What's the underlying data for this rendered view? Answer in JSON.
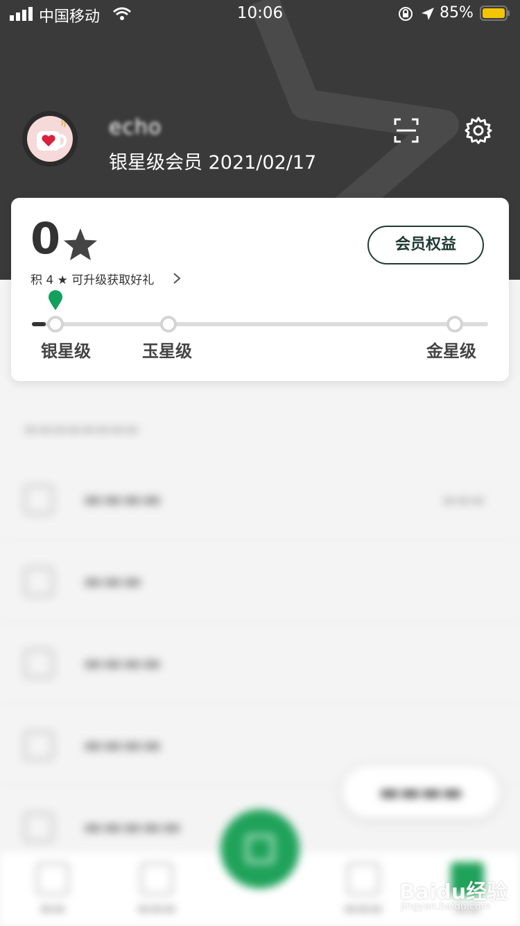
{
  "status_bar": {
    "carrier": "中国移动",
    "time": "10:06",
    "battery_percent": "85%",
    "icons": [
      "signal-icon",
      "wifi-icon",
      "orientation-lock-icon",
      "location-icon",
      "battery-icon"
    ]
  },
  "profile": {
    "username": "echo",
    "member_line": "银星级会员 2021/02/17",
    "actions": [
      "scan-icon",
      "gear-icon"
    ]
  },
  "stars": {
    "count": "0",
    "upgrade_text": "积 4 ★ 可升级获取好礼",
    "benefits_button": "会员权益",
    "progress_fraction": 0.03
  },
  "tiers": [
    {
      "label": "银星级"
    },
    {
      "label": "玉星级"
    },
    {
      "label": "金星级"
    }
  ],
  "colors": {
    "header_bg": "#3a3a3a",
    "accent_green": "#1fa25a",
    "button_border": "#1f3b33"
  },
  "watermark": {
    "main": "Baidu经验",
    "sub": "jingyan.baidu.com"
  }
}
